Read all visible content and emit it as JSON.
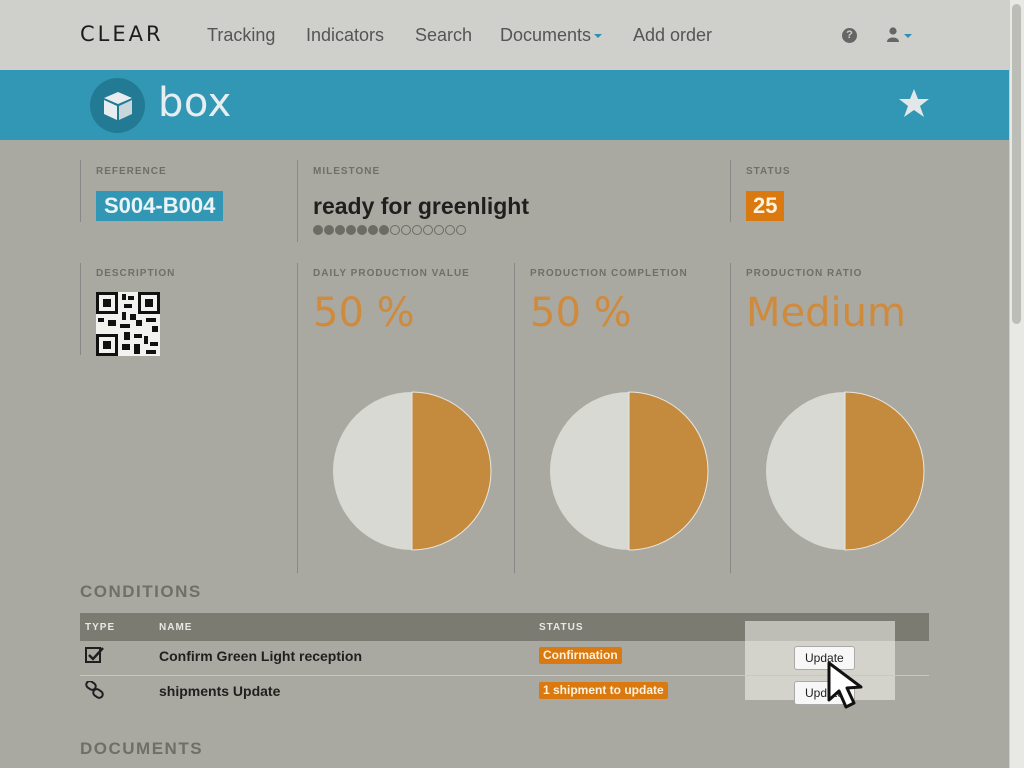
{
  "nav": {
    "brand": "CLEAR",
    "items": [
      "Tracking",
      "Indicators",
      "Search",
      "Documents",
      "Add order"
    ],
    "help_icon": "question-circle-icon",
    "user_icon": "user-icon"
  },
  "banner": {
    "icon": "box-icon",
    "title": "box",
    "star_icon": "star-icon"
  },
  "summary": {
    "reference_label": "REFERENCE",
    "reference_value": "S004-B004",
    "milestone_label": "MILESTONE",
    "milestone_value": "ready for greenlight",
    "milestone_progress": {
      "completed": 7,
      "total": 14
    },
    "status_label": "STATUS",
    "status_value": "25"
  },
  "indicators": {
    "description_label": "DESCRIPTION",
    "daily_label": "DAILY PRODUCTION VALUE",
    "daily_value": "50 %",
    "daily_fraction": 0.5,
    "completion_label": "PRODUCTION COMPLETION",
    "completion_value": "50 %",
    "completion_fraction": 0.5,
    "ratio_label": "PRODUCTION RATIO",
    "ratio_value": "Medium",
    "ratio_fraction": 0.5
  },
  "conditions": {
    "title": "CONDITIONS",
    "headers": {
      "type": "TYPE",
      "name": "NAME",
      "status": "STATUS"
    },
    "rows": [
      {
        "type_icon": "check-square-icon",
        "name": "Confirm Green Light reception",
        "status": "Confirmation",
        "action": "Update"
      },
      {
        "type_icon": "link-icon",
        "name": "shipments Update",
        "status": "1 shipment to update",
        "action": "Update"
      }
    ]
  },
  "documents": {
    "title": "DOCUMENTS"
  },
  "colors": {
    "accent": "#3297b4",
    "status": "#d9790f",
    "chart_fill": "#c48a3e",
    "chart_rest": "#d9d9d4"
  }
}
